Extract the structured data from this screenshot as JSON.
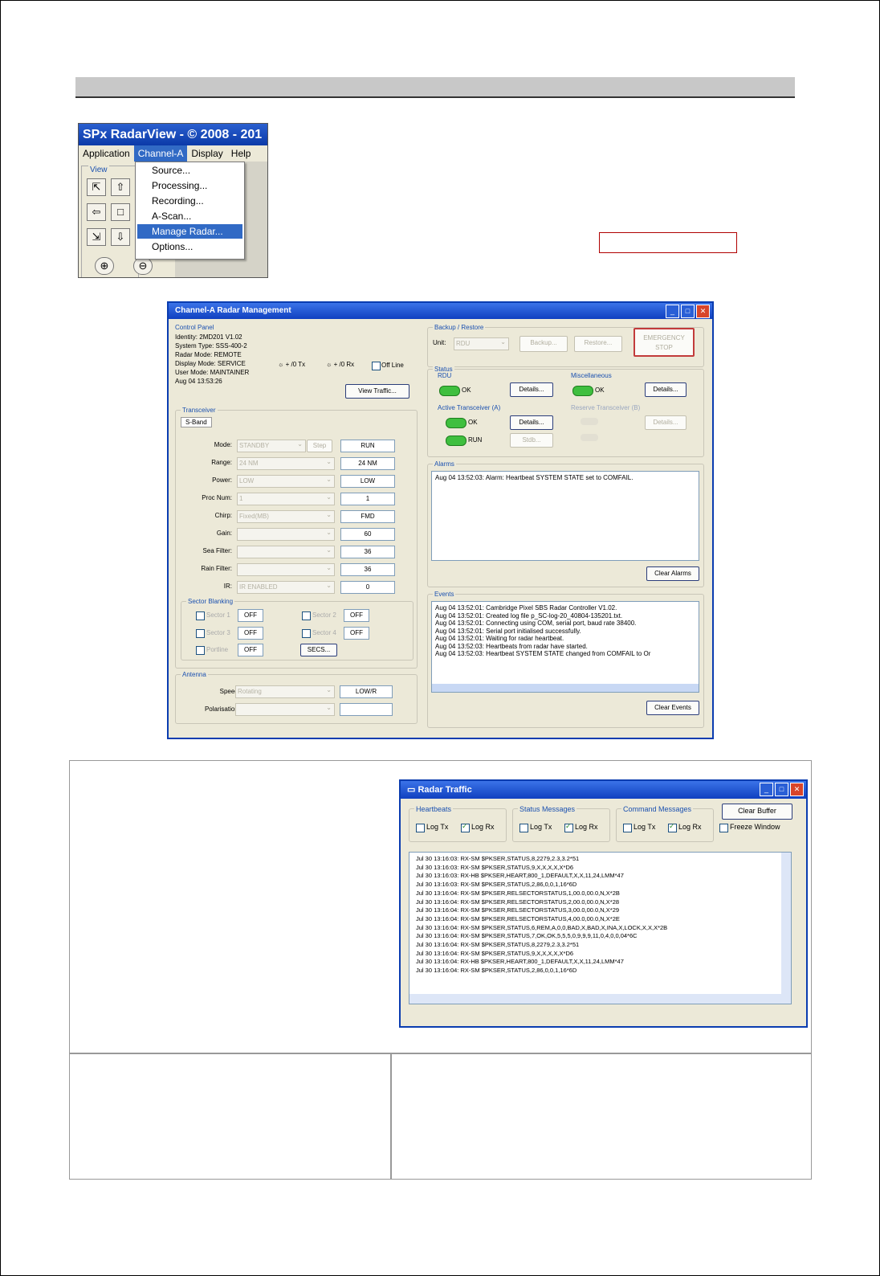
{
  "menu_screenshot": {
    "title": "SPx RadarView - © 2008 - 201",
    "menubar": [
      "Application",
      "Channel-A",
      "Display",
      "Help"
    ],
    "view_label": "View",
    "channel_menu_items": [
      "Source...",
      "Processing...",
      "Recording...",
      "A-Scan...",
      "Manage Radar...",
      "Options..."
    ],
    "selected_item": "Manage Radar..."
  },
  "management_dialog": {
    "title": "Channel-A Radar Management",
    "control_panel": {
      "label": "Control Panel",
      "info_lines": [
        "Identity: 2MD201 V1.02",
        "System Type: SSS-400-2",
        "Radar Mode: REMOTE",
        "Display Mode: SERVICE",
        "User Mode: MAINTAINER",
        "Aug 04 13:53:26"
      ],
      "tx_label": "+ /0 Tx",
      "rx_label": "+ /0 Rx",
      "off_line_label": "Off Line",
      "view_traffic_button": "View Traffic..."
    },
    "transceiver": {
      "label": "Transceiver",
      "tab": "S-Band",
      "rows": [
        {
          "label": "Mode:",
          "combo": "STANDBY",
          "extra": "Step",
          "value": "RUN"
        },
        {
          "label": "Range:",
          "combo": "24 NM",
          "extra": "",
          "value": "24 NM"
        },
        {
          "label": "Power:",
          "combo": "LOW",
          "extra": "",
          "value": "LOW"
        },
        {
          "label": "Proc Num:",
          "combo": "1",
          "extra": "",
          "value": "1"
        },
        {
          "label": "Chirp:",
          "combo": "Fixed(MB)",
          "extra": "",
          "value": "FMD"
        },
        {
          "label": "Gain:",
          "combo": "",
          "extra": "",
          "value": "60"
        },
        {
          "label": "Sea Filter:",
          "combo": "",
          "extra": "",
          "value": "36"
        },
        {
          "label": "Rain Filter:",
          "combo": "",
          "extra": "",
          "value": "36"
        },
        {
          "label": "IR:",
          "combo": "IR ENABLED",
          "extra": "",
          "value": "0"
        }
      ]
    },
    "sector_blanking": {
      "label": "Sector Blanking",
      "sectors": [
        {
          "label": "Sector 1",
          "value": "OFF"
        },
        {
          "label": "Sector 2",
          "value": "OFF"
        },
        {
          "label": "Sector 3",
          "value": "OFF"
        },
        {
          "label": "Sector 4",
          "value": "OFF"
        },
        {
          "label": "Portline",
          "value": "OFF"
        }
      ],
      "set_button": "SECS..."
    },
    "antenna": {
      "label": "Antenna",
      "speed_label": "Speed:",
      "speed_combo": "Rotating",
      "speed_value": "LOW/R",
      "polarisation_label": "Polarisation:"
    },
    "backup_restore": {
      "label": "Backup / Restore",
      "unit_label": "Unit:",
      "unit_value": "RDU",
      "backup_button": "Backup...",
      "restore_button": "Restore...",
      "emergency_stop_button": "EMERGENCY STOP"
    },
    "status": {
      "label": "Status",
      "rdu_label": "RDU",
      "rdu_status": "OK",
      "rdu_details": "Details...",
      "misc_label": "Miscellaneous",
      "misc_status": "OK",
      "misc_details": "Details...",
      "active_label": "Active Transceiver (A)",
      "active_status": "OK",
      "active_details": "Details...",
      "run_status": "RUN",
      "standby_button": "Stdb...",
      "reserve_label": "Reserve Transceiver (B)",
      "reserve_details": "Details..."
    },
    "alarms": {
      "label": "Alarms",
      "lines": [
        "Aug 04 13:52:03: Alarm: Heartbeat SYSTEM STATE set to COMFAIL."
      ],
      "clear_button": "Clear Alarms"
    },
    "events": {
      "label": "Events",
      "lines": [
        "Aug 04 13:52:01: Cambridge Pixel SBS Radar Controller V1.02.",
        "Aug 04 13:52:01: Created log file p_SC-log-20_40804-135201.txt.",
        "Aug 04 13:52:01: Connecting using COM, serial port, baud rate 38400.",
        "Aug 04 13:52:01: Serial port initialised successfully.",
        "Aug 04 13:52:01: Waiting for radar heartbeat.",
        "Aug 04 13:52:03: Heartbeats from radar have started.",
        "Aug 04 13:52:03: Heartbeat SYSTEM STATE changed from COMFAIL to Or"
      ],
      "clear_button": "Clear Events"
    }
  },
  "radar_traffic": {
    "title": "Radar Traffic",
    "groups": [
      {
        "label": "Heartbeats",
        "tx_label": "Log Tx",
        "rx_label": "Log Rx",
        "tx_checked": false,
        "rx_checked": true
      },
      {
        "label": "Status Messages",
        "tx_label": "Log Tx",
        "rx_label": "Log Rx",
        "tx_checked": false,
        "rx_checked": true
      },
      {
        "label": "Command Messages",
        "tx_label": "Log Tx",
        "rx_label": "Log Rx",
        "tx_checked": false,
        "rx_checked": true
      }
    ],
    "clear_buffer_button": "Clear Buffer",
    "freeze_window_label": "Freeze Window",
    "log_lines": [
      "Jul 30 13:16:03: RX-SM $PKSER,STATUS,8,2279,2.3,3.2*51",
      "Jul 30 13:16:03: RX-SM $PKSER,STATUS,9,X,X,X,X,X*D6",
      "Jul 30 13:16:03: RX-HB $PKSER,HEART,800_1,DEFAULT,X,X,11,24,LMM*47",
      "Jul 30 13:16:03: RX-SM $PKSER,STATUS,2,86,0,0,1,16*6D",
      "Jul 30 13:16:04: RX-SM $PKSER,RELSECTORSTATUS,1,00.0,00.0,N,X*2B",
      "Jul 30 13:16:04: RX-SM $PKSER,RELSECTORSTATUS,2,00.0,00.0,N,X*28",
      "Jul 30 13:16:04: RX-SM $PKSER,RELSECTORSTATUS,3,00.0,00.0,N,X*29",
      "Jul 30 13:16:04: RX-SM $PKSER,RELSECTORSTATUS,4,00.0,00.0,N,X*2E",
      "Jul 30 13:16:04: RX-SM $PKSER,STATUS,6,REM,A,0,0,BAD,X,BAD,X,INA,X,LOCK,X,X,X*2B",
      "Jul 30 13:16:04: RX-SM $PKSER,STATUS,7,OK,OK,5,5,5,0,9,9,9,11,0,4,0,0,04*6C",
      "Jul 30 13:16:04: RX-SM $PKSER,STATUS,8,2279,2.3,3.2*51",
      "Jul 30 13:16:04: RX-SM $PKSER,STATUS,9,X,X,X,X,X*D6",
      "Jul 30 13:16:04: RX-HB $PKSER,HEART,800_1,DEFAULT,X,X,11,24,LMM*47",
      "Jul 30 13:16:04: RX-SM $PKSER,STATUS,2,86,0,0,1,16*6D"
    ]
  }
}
